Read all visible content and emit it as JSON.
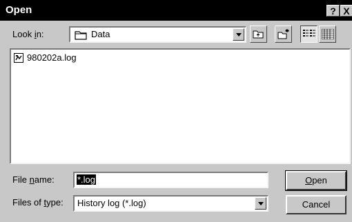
{
  "window": {
    "title": "Open",
    "help_label": "?",
    "close_label": "X"
  },
  "look_in": {
    "label_pre": "Look ",
    "label_u": "i",
    "label_post": "n:",
    "value": "Data"
  },
  "toolbar": {
    "up_icon": "up-folder-icon",
    "new_folder_icon": "new-folder-icon",
    "list_icon": "list-view-icon",
    "details_icon": "details-view-icon"
  },
  "files": [
    {
      "name": "980202a.log",
      "icon": "log-file-icon"
    }
  ],
  "file_name": {
    "label_pre": "File ",
    "label_u": "n",
    "label_post": "ame:",
    "value": "*.log"
  },
  "file_type": {
    "label_pre": "Files of ",
    "label_u": "t",
    "label_post": "ype:",
    "value": "History log (*.log)"
  },
  "buttons": {
    "open_u": "O",
    "open_rest": "pen",
    "cancel": "Cancel"
  }
}
